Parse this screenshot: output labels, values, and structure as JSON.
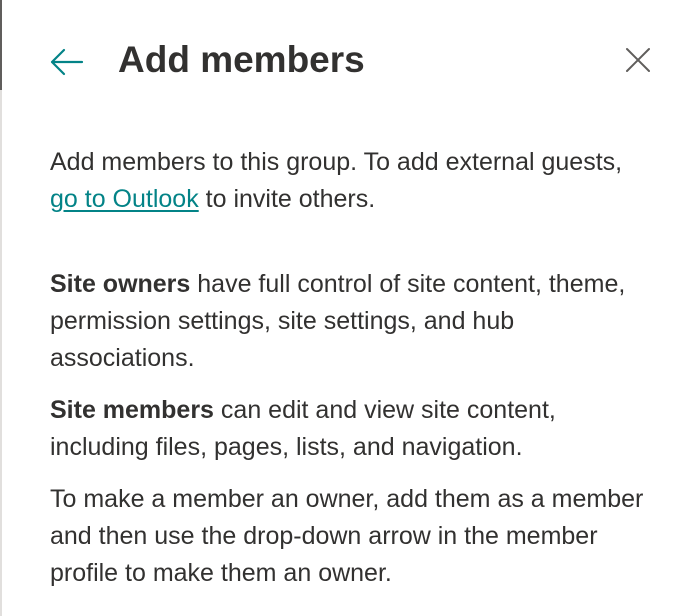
{
  "panel": {
    "title": "Add members",
    "back_icon": "arrow-left-icon",
    "close_icon": "close-icon"
  },
  "intro": {
    "text_before_link": "Add members to this group. To add external guests, ",
    "link_text": "go to Outlook",
    "text_after_link": " to invite others."
  },
  "owners": {
    "label": "Site owners",
    "text": " have full control of site content, theme, permission settings, site settings, and hub associations."
  },
  "members": {
    "label": "Site members",
    "text": " can edit and view site content, including files, pages, lists, and navigation."
  },
  "owner_tip": {
    "text": "To make a member an owner, add them as a member and then use the drop-down arrow in the member profile to make them an owner."
  },
  "colors": {
    "accent": "#038387",
    "text": "#323130",
    "icon": "#605e5c"
  }
}
